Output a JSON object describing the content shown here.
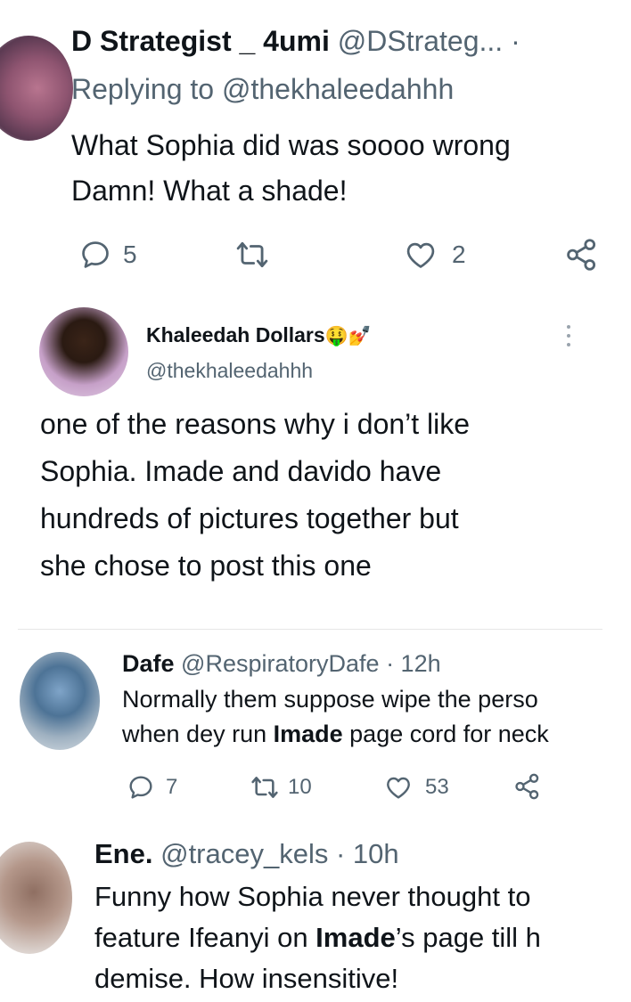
{
  "tweet1": {
    "name": "D Strategist _ 4umi",
    "handle": "@DStrateg...",
    "dot": "·",
    "replying_prefix": "Replying to",
    "replying_handle": "@thekhaleedahhh",
    "text_line1": "What Sophia did was soooo wrong",
    "text_line2": "Damn! What a shade!",
    "replies": "5",
    "likes": "2"
  },
  "quoted": {
    "name": "Khaleedah Dollars",
    "name_emoji": "🤑💅",
    "handle": "@thekhaleedahhh",
    "text_line1": "one of the reasons why i don’t like",
    "text_line2": "Sophia. Imade and davido have",
    "text_line3": "hundreds of pictures together but",
    "text_line4": "she chose to post this one"
  },
  "tweet2": {
    "name": "Dafe",
    "handle": "@RespiratoryDafe",
    "time": "· 12h",
    "text_line1": "Normally them suppose wipe the perso",
    "text_line2_a": "when dey run ",
    "text_line2_bold": "Imade",
    "text_line2_b": " page cord for neck",
    "replies": "7",
    "retweets": "10",
    "likes": "53"
  },
  "tweet3": {
    "name": "Ene.",
    "handle": "@tracey_kels",
    "time": "· 10h",
    "text_line1": "Funny how Sophia never thought to",
    "text_line2_a": "feature Ifeanyi on ",
    "text_line2_bold": "Imade",
    "text_line2_b": "’s page till h",
    "text_line3": "demise. How insensitive!"
  },
  "colors": {
    "text": "#0f1419",
    "muted": "#536471",
    "divider": "#e6e6e6"
  },
  "icons": [
    "reply-icon",
    "retweet-icon",
    "like-icon",
    "share-icon",
    "more-icon"
  ]
}
